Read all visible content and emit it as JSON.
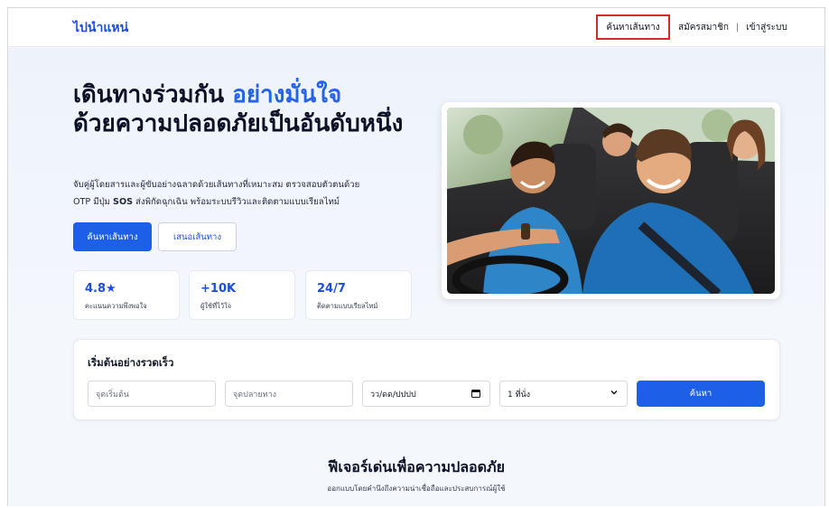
{
  "navbar": {
    "brand": "ไปนำแหน่",
    "active_link": "ค้นหาเส้นทาง",
    "register": "สมัครสมาชิก",
    "separator": "|",
    "login": "เข้าสู่ระบบ"
  },
  "hero": {
    "title_part1": "เดินทางร่วมกัน ",
    "title_accent": "อย่างมั่นใจ",
    "title_part2": "ด้วยความปลอดภัยเป็นอันดับหนึ่ง",
    "description_line1": "จับคู่ผู้โดยสารและผู้ขับอย่างฉลาดด้วยเส้นทางที่เหมาะสม ตรวจสอบตัวตนด้วย",
    "description_line2_a": "OTP มีปุ่ม ",
    "description_line2_bold": "SOS",
    "description_line2_b": " ส่งพิกัดฉุกเฉิน พร้อมระบบรีวิวและติดตามแบบเรียลไทม์",
    "btn_primary": "ค้นหาเส้นทาง",
    "btn_secondary": "เสนอเส้นทาง"
  },
  "stats": [
    {
      "value": "4.8★",
      "label": "คะแนนความพึงพอใจ"
    },
    {
      "value": "+10K",
      "label": "ผู้ใช้ที่ไว้ใจ"
    },
    {
      "value": "24/7",
      "label": "ติดตามแบบเรียลไทม์"
    }
  ],
  "search": {
    "title": "เริ่มต้นอย่างรวดเร็ว",
    "origin_placeholder": "จุดเริ่มต้น",
    "destination_placeholder": "จุดปลายทาง",
    "date_placeholder": "วว/ดด/ปปปป",
    "date_icon": "calendar-icon",
    "seats_value": "1 ที่นั่ง",
    "seats_icon": "chevron-down-icon",
    "button": "ค้นหา"
  },
  "features": {
    "title": "ฟีเจอร์เด่นเพื่อความปลอดภัย",
    "subtitle": "ออกแบบโดยคำนึงถึงความน่าเชื่อถือและประสบการณ์ผู้ใช้"
  },
  "colors": {
    "accent": "#1d5fe6",
    "brand": "#1d4ed8",
    "highlight_box": "#d22b2b"
  }
}
